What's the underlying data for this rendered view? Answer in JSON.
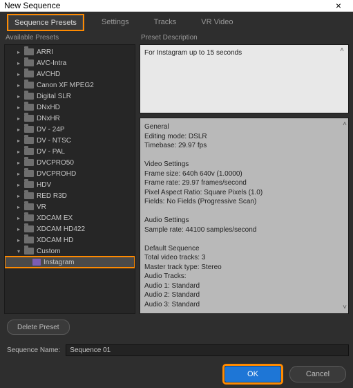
{
  "window": {
    "title": "New Sequence"
  },
  "tabs": {
    "items": [
      {
        "label": "Sequence Presets",
        "active": true,
        "highlight": true
      },
      {
        "label": "Settings",
        "active": false,
        "highlight": false
      },
      {
        "label": "Tracks",
        "active": false,
        "highlight": false
      },
      {
        "label": "VR Video",
        "active": false,
        "highlight": false
      }
    ]
  },
  "left": {
    "label": "Available Presets",
    "items": [
      {
        "label": "ARRI",
        "kind": "folder",
        "depth": 1,
        "collapsed": true
      },
      {
        "label": "AVC-Intra",
        "kind": "folder",
        "depth": 1,
        "collapsed": true
      },
      {
        "label": "AVCHD",
        "kind": "folder",
        "depth": 1,
        "collapsed": true
      },
      {
        "label": "Canon XF MPEG2",
        "kind": "folder",
        "depth": 1,
        "collapsed": true
      },
      {
        "label": "Digital SLR",
        "kind": "folder",
        "depth": 1,
        "collapsed": true
      },
      {
        "label": "DNxHD",
        "kind": "folder",
        "depth": 1,
        "collapsed": true
      },
      {
        "label": "DNxHR",
        "kind": "folder",
        "depth": 1,
        "collapsed": true
      },
      {
        "label": "DV - 24P",
        "kind": "folder",
        "depth": 1,
        "collapsed": true
      },
      {
        "label": "DV - NTSC",
        "kind": "folder",
        "depth": 1,
        "collapsed": true
      },
      {
        "label": "DV - PAL",
        "kind": "folder",
        "depth": 1,
        "collapsed": true
      },
      {
        "label": "DVCPRO50",
        "kind": "folder",
        "depth": 1,
        "collapsed": true
      },
      {
        "label": "DVCPROHD",
        "kind": "folder",
        "depth": 1,
        "collapsed": true
      },
      {
        "label": "HDV",
        "kind": "folder",
        "depth": 1,
        "collapsed": true
      },
      {
        "label": "RED R3D",
        "kind": "folder",
        "depth": 1,
        "collapsed": true
      },
      {
        "label": "VR",
        "kind": "folder",
        "depth": 1,
        "collapsed": true
      },
      {
        "label": "XDCAM EX",
        "kind": "folder",
        "depth": 1,
        "collapsed": true
      },
      {
        "label": "XDCAM HD422",
        "kind": "folder",
        "depth": 1,
        "collapsed": true
      },
      {
        "label": "XDCAM HD",
        "kind": "folder",
        "depth": 1,
        "collapsed": true
      },
      {
        "label": "Custom",
        "kind": "folder",
        "depth": 1,
        "collapsed": false
      },
      {
        "label": "Instagram",
        "kind": "preset",
        "depth": 2,
        "collapsed": null,
        "selected": true,
        "highlight": true
      }
    ]
  },
  "right": {
    "desc_label": "Preset Description",
    "description": "For Instagram up to 15 seconds",
    "info": [
      "General",
      "Editing mode: DSLR",
      "Timebase: 29.97 fps",
      "",
      "Video Settings",
      "Frame size: 640h 640v (1.0000)",
      "Frame rate: 29.97  frames/second",
      "Pixel Aspect Ratio: Square Pixels (1.0)",
      "Fields: No Fields (Progressive Scan)",
      "",
      "Audio Settings",
      "Sample rate: 44100 samples/second",
      "",
      "Default Sequence",
      "Total video tracks: 3",
      "Master track type: Stereo",
      "Audio Tracks:",
      "Audio 1: Standard",
      "Audio 2: Standard",
      "Audio 3: Standard"
    ]
  },
  "footer": {
    "delete_label": "Delete Preset",
    "seqname_label": "Sequence Name:",
    "seqname_value": "Sequence 01",
    "ok_label": "OK",
    "cancel_label": "Cancel"
  }
}
